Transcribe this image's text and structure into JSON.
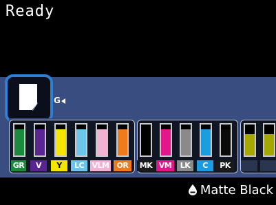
{
  "status": {
    "text": "Ready"
  },
  "feed": {
    "label": "G"
  },
  "inks": [
    {
      "code": "GR",
      "color": "#1a8a3c",
      "label_bg": "#1a8a3c",
      "level": 0.85
    },
    {
      "code": "V",
      "color": "#5a2590",
      "label_bg": "#5a2590",
      "level": 0.85
    },
    {
      "code": "Y",
      "color": "#f5e600",
      "label_bg": "#f5e600",
      "label_fg": "#000",
      "level": 0.85
    },
    {
      "code": "LC",
      "color": "#6cc6ec",
      "label_bg": "#6cc6ec",
      "level": 0.85
    },
    {
      "code": "VLM",
      "color": "#f3b1d4",
      "label_bg": "#f3b1d4",
      "level": 0.85
    },
    {
      "code": "OR",
      "color": "#f07a1c",
      "label_bg": "#f07a1c",
      "level": 0.85
    },
    {
      "code": "MK",
      "color": "#000000",
      "label_bg": "#1a1a1a",
      "level": 0.85
    },
    {
      "code": "VM",
      "color": "#e4168c",
      "label_bg": "#e4168c",
      "level": 0.85
    },
    {
      "code": "LK",
      "color": "#8a8a8a",
      "label_bg": "#8a8a8a",
      "level": 0.85
    },
    {
      "code": "C",
      "color": "#1a9ee0",
      "label_bg": "#1a9ee0",
      "level": 0.85
    },
    {
      "code": "PK",
      "color": "#0a0a0a",
      "label_bg": "#1a1a1a",
      "level": 0.85
    },
    {
      "code": "",
      "color": "#a5a800",
      "label_bg": "#2a3550",
      "level": 0.7
    },
    {
      "code": "",
      "color": "#a5a800",
      "label_bg": "#2a3550",
      "level": 0.7
    }
  ],
  "active_ink": {
    "name": "Matte Black",
    "icon": "ink-drop-icon"
  },
  "colors": {
    "band": "#3a4d80",
    "selection_border": "#2e7fd4"
  }
}
